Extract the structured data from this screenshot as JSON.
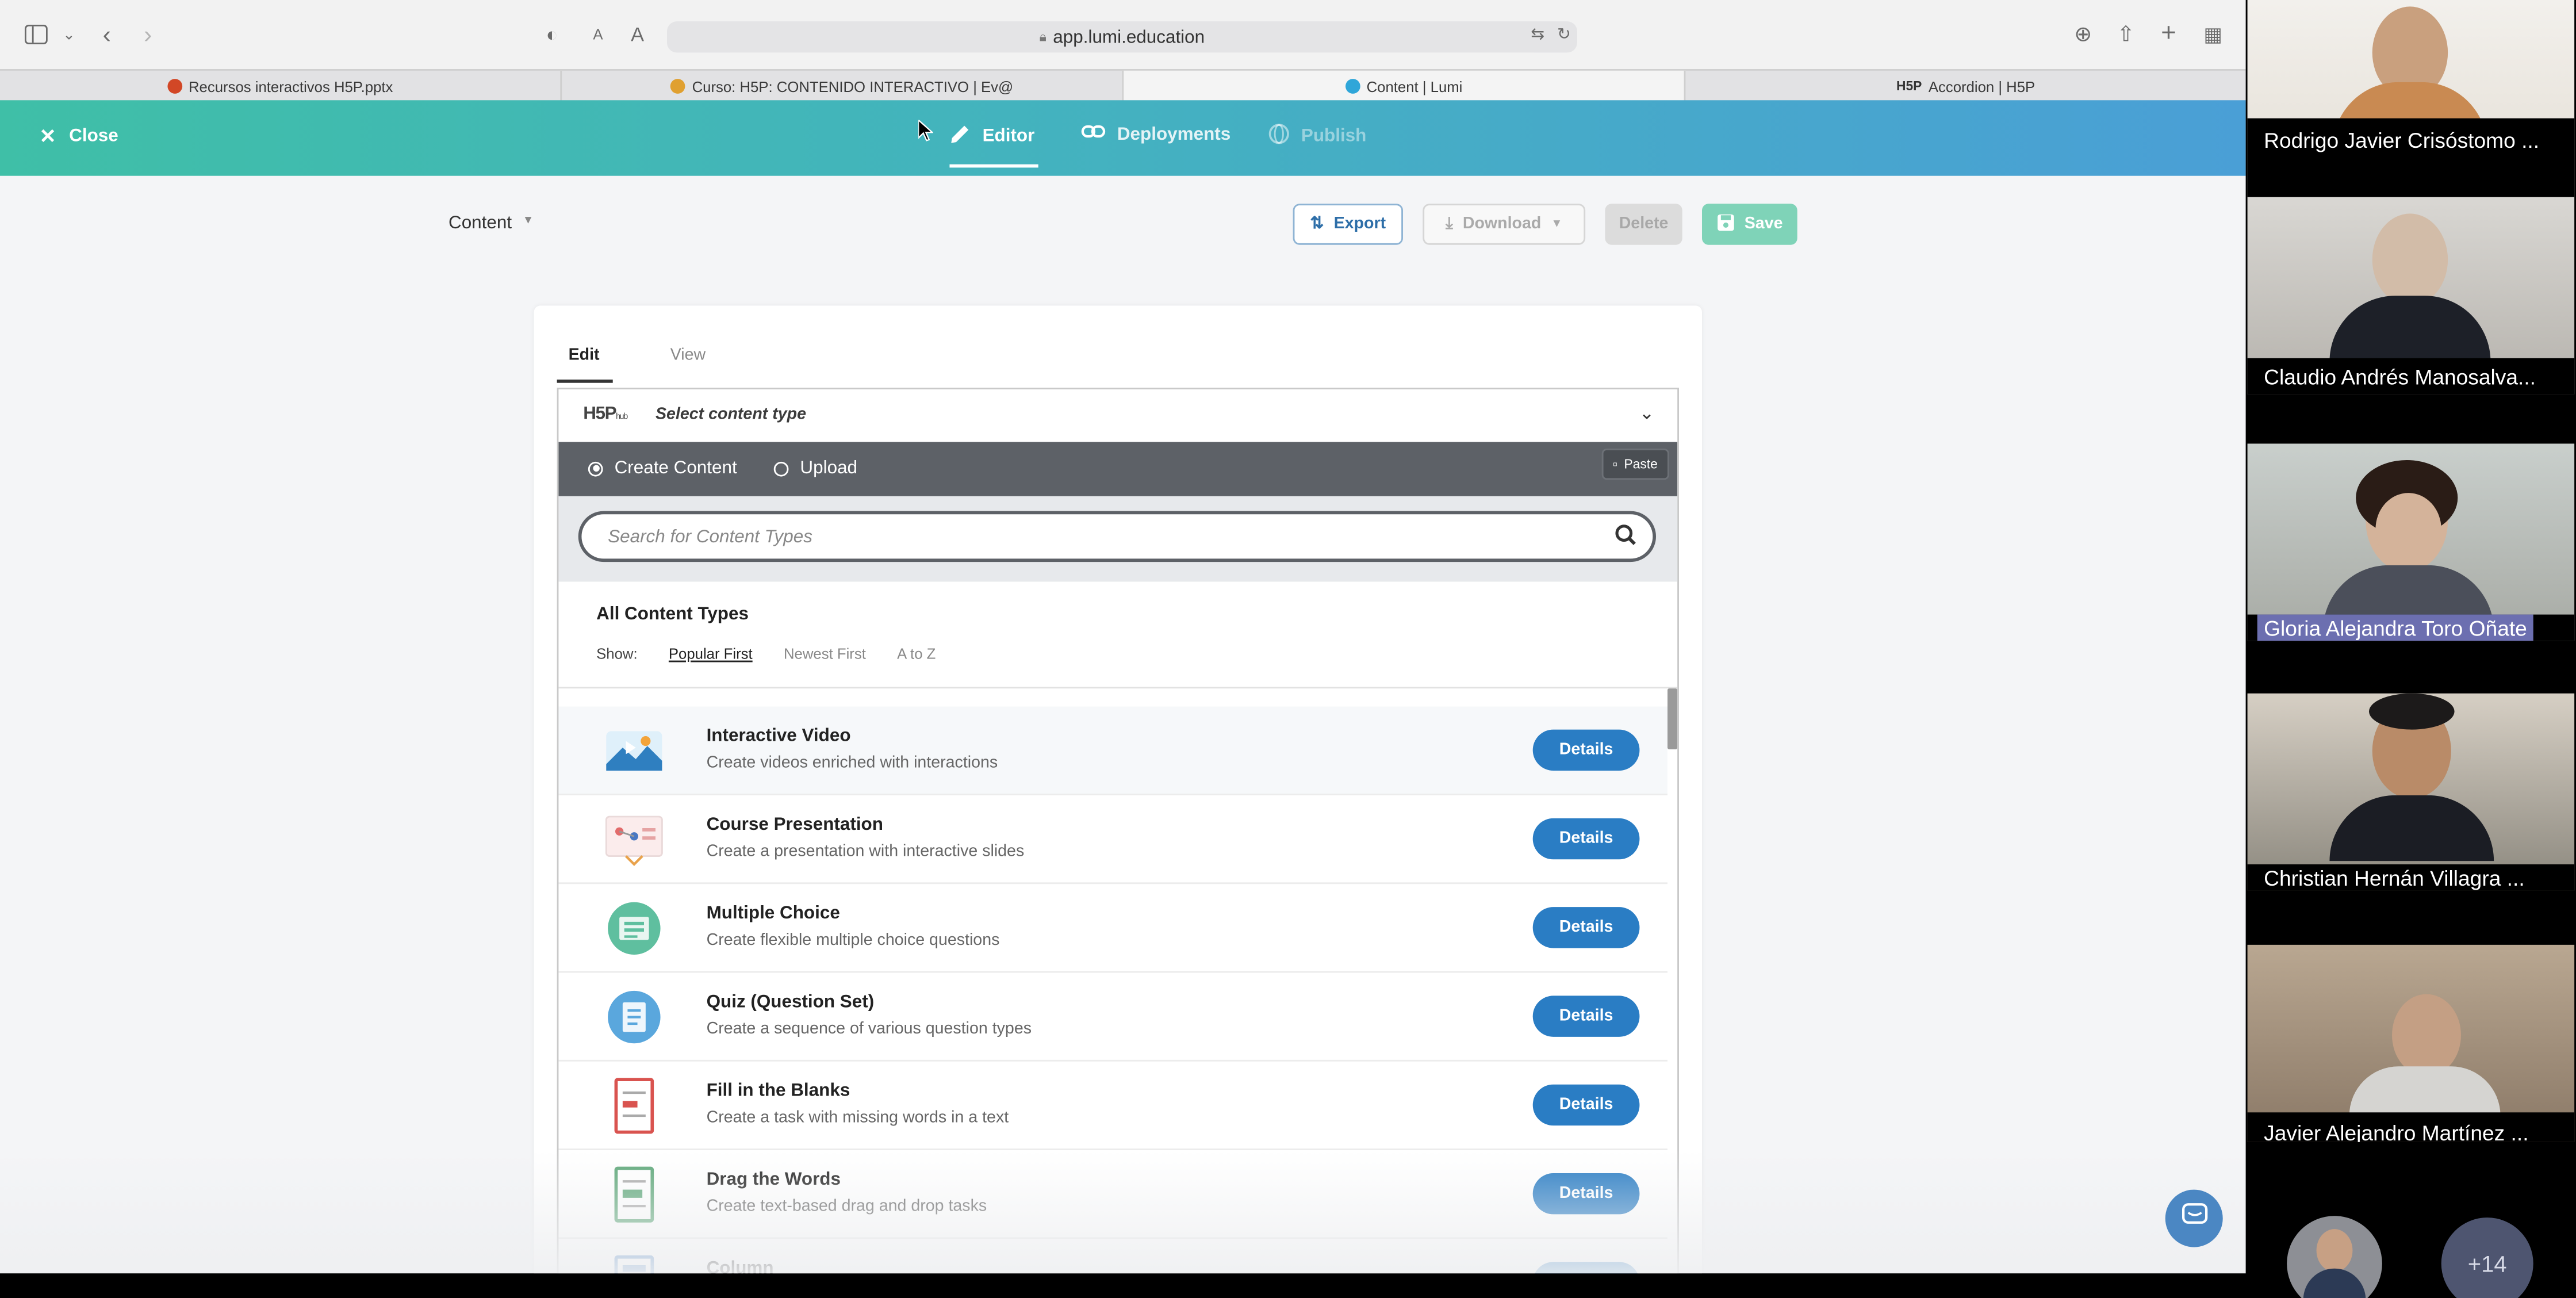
{
  "browser": {
    "url": "app.lumi.education",
    "tabs": [
      {
        "label": "Recursos interactivos H5P.pptx",
        "color": "#d24726"
      },
      {
        "label": "Curso: H5P: CONTENIDO INTERACTIVO | Ev@",
        "color": "#e0a030"
      },
      {
        "label": "Content | Lumi",
        "color": "#2fa6d9"
      },
      {
        "label": "Accordion | H5P",
        "color": "#333333"
      }
    ]
  },
  "header": {
    "close_label": "Close",
    "editor_label": "Editor",
    "deployments_label": "Deployments",
    "publish_label": "Publish"
  },
  "actions": {
    "content_label": "Content",
    "export_label": "Export",
    "download_label": "Download",
    "delete_label": "Delete",
    "save_label": "Save"
  },
  "editor": {
    "edit_tab": "Edit",
    "view_tab": "View",
    "hub_title": "Select content type",
    "create_label": "Create Content",
    "upload_label": "Upload",
    "paste_label": "Paste",
    "search_placeholder": "Search for Content Types",
    "all_types": "All Content Types",
    "show_label": "Show:",
    "sort_popular": "Popular First",
    "sort_newest": "Newest First",
    "sort_az": "A to Z",
    "details_label": "Details",
    "content_types": [
      {
        "title": "Interactive Video",
        "desc": "Create videos enriched with interactions"
      },
      {
        "title": "Course Presentation",
        "desc": "Create a presentation with interactive slides"
      },
      {
        "title": "Multiple Choice",
        "desc": "Create flexible multiple choice questions"
      },
      {
        "title": "Quiz (Question Set)",
        "desc": "Create a sequence of various question types"
      },
      {
        "title": "Fill in the Blanks",
        "desc": "Create a task with missing words in a text"
      },
      {
        "title": "Drag the Words",
        "desc": "Create text-based drag and drop tasks"
      },
      {
        "title": "Column",
        "desc": ""
      }
    ]
  },
  "participants": [
    {
      "name": "Rodrigo Javier Crisóstomo ..."
    },
    {
      "name": "Claudio Andrés Manosalva..."
    },
    {
      "name": "Gloria Alejandra Toro Oñate"
    },
    {
      "name": "Christian Hernán Villagra ..."
    },
    {
      "name": "Javier Alejandro Martínez ..."
    }
  ],
  "more_participants": "+14",
  "colors": {
    "accent_teal": "#3fbfa7",
    "accent_blue": "#4a9fd6",
    "details_blue": "#2a7dc4",
    "hub_bar": "#5d6167"
  }
}
